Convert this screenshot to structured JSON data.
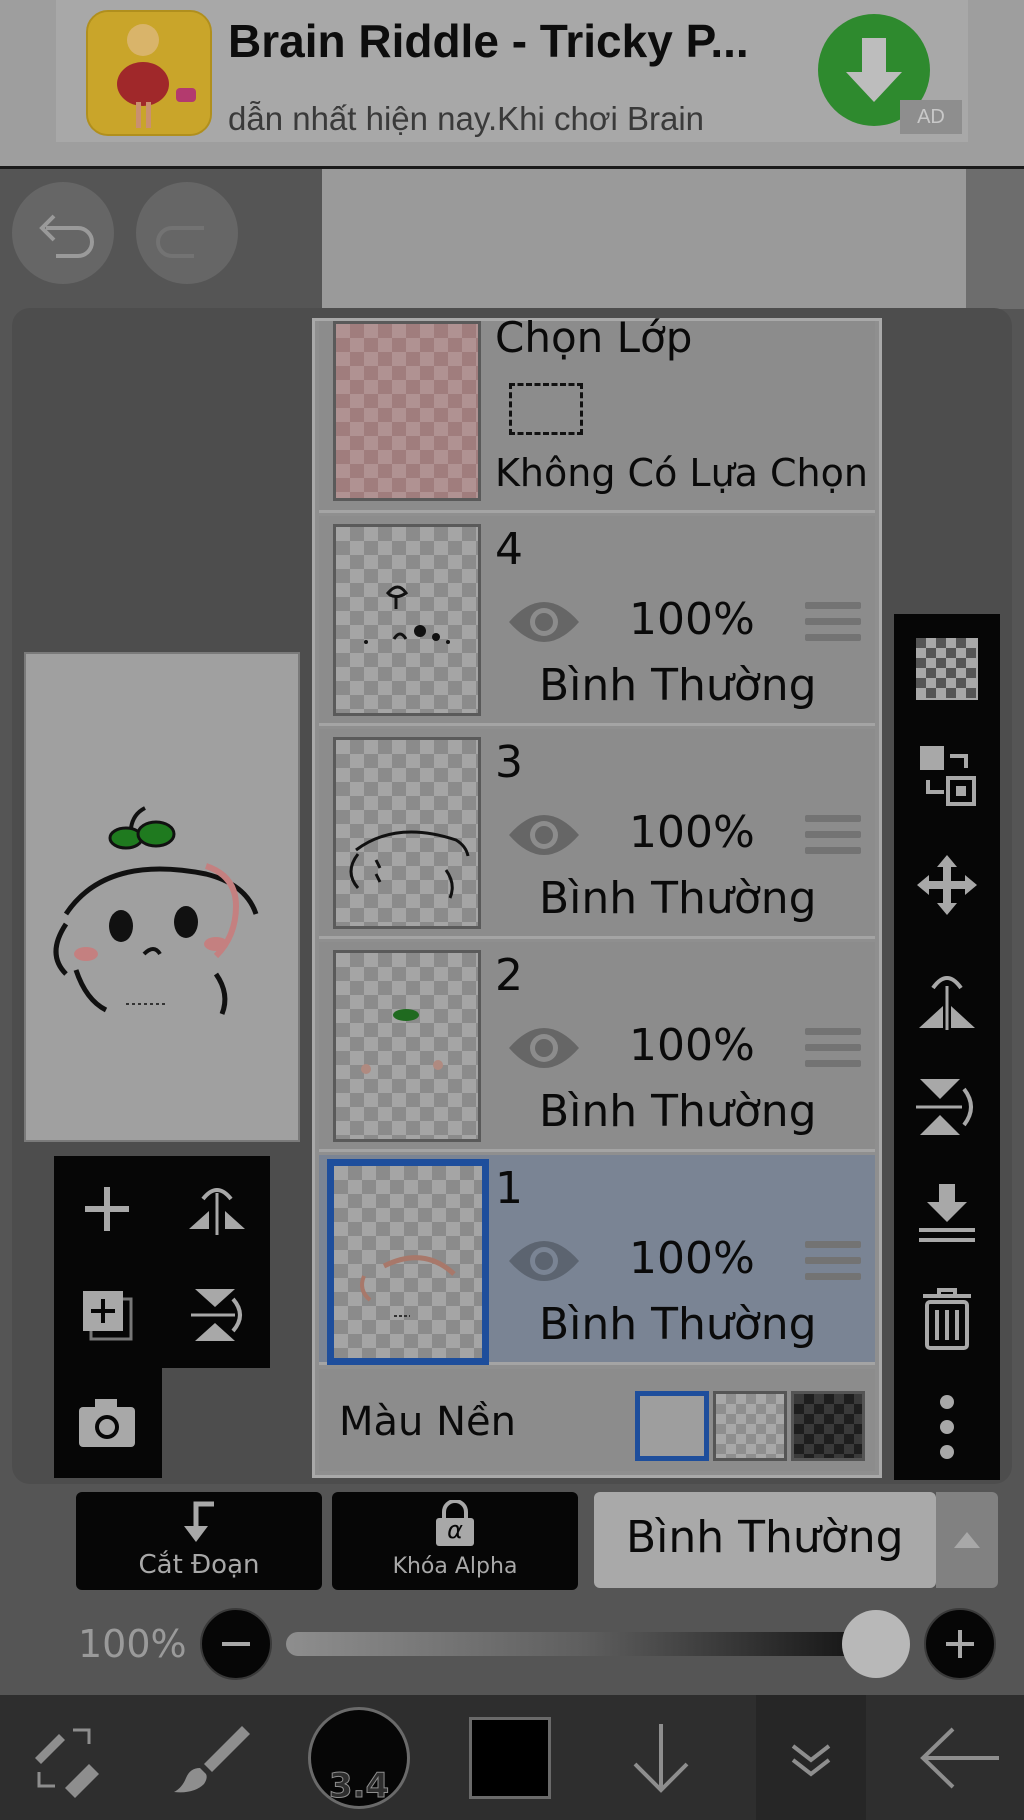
{
  "ad": {
    "title": "Brain Riddle - Tricky P...",
    "subtitle": "dẫn nhất hiện nay.Khi chơi Brain",
    "badge": "AD",
    "download_color": "#2e8a2e"
  },
  "layers": {
    "selection_layer": {
      "title": "Chọn Lớp",
      "status": "Không Có Lựa Chọn"
    },
    "items": [
      {
        "name": "4",
        "opacity": "100%",
        "blend": "Bình Thường",
        "selected": false
      },
      {
        "name": "3",
        "opacity": "100%",
        "blend": "Bình Thường",
        "selected": false
      },
      {
        "name": "2",
        "opacity": "100%",
        "blend": "Bình Thường",
        "selected": false
      },
      {
        "name": "1",
        "opacity": "100%",
        "blend": "Bình Thường",
        "selected": true
      }
    ],
    "background_label": "Màu Nền"
  },
  "controls": {
    "clipping_label": "Cắt Đoạn",
    "alpha_lock_label": "Khóa Alpha",
    "alpha_symbol": "α",
    "blend_mode": "Bình Thường",
    "opacity_label": "100%",
    "opacity_value": 1.0
  },
  "bottom_bar": {
    "brush_size": "3.4"
  },
  "colors": {
    "selected_border": "#1e4e9c",
    "selected_row": "#7a8494",
    "current_color": "#000000"
  }
}
